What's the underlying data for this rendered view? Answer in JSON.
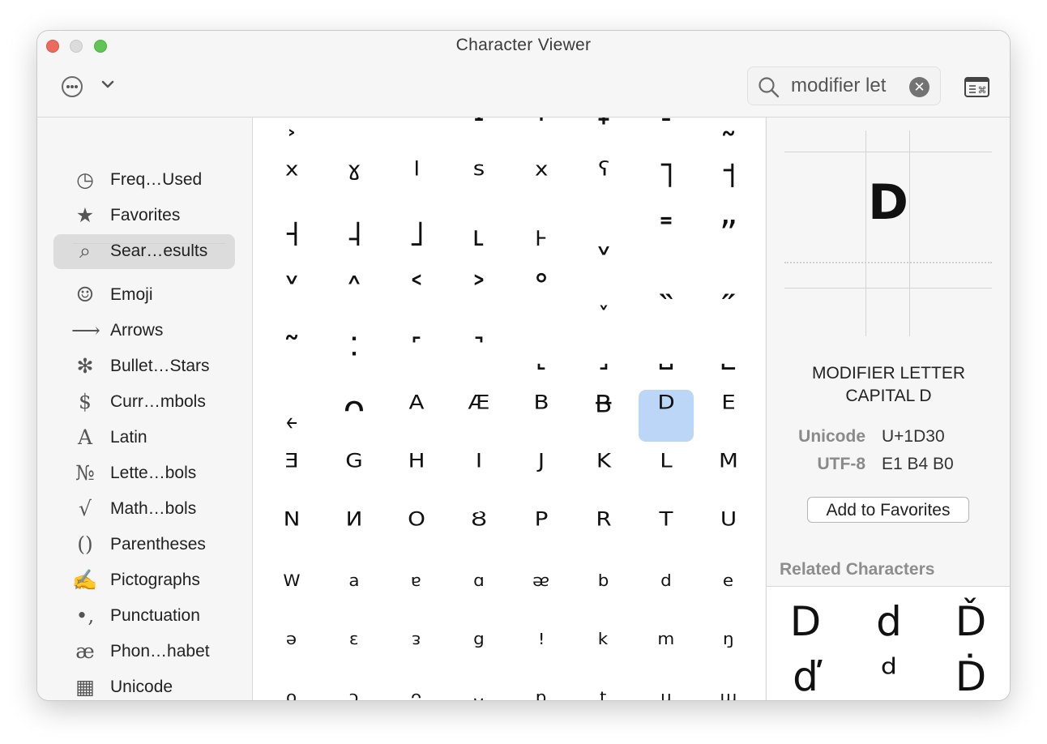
{
  "window": {
    "title": "Character Viewer"
  },
  "toolbar": {
    "search_query": "modifier let",
    "clear_label": "✕"
  },
  "sidebar": {
    "items": [
      {
        "label": "Freq…Used",
        "icon": "clock-icon",
        "glyph": "◷"
      },
      {
        "label": "Favorites",
        "icon": "star-icon",
        "glyph": "★"
      },
      {
        "label": "Sear…esults",
        "icon": "search-icon",
        "glyph": "⌕"
      },
      {
        "label": "Emoji",
        "icon": "smiley-icon",
        "glyph": "☺"
      },
      {
        "label": "Arrows",
        "icon": "arrow-icon",
        "glyph": "⟶"
      },
      {
        "label": "Bullet…Stars",
        "icon": "asterisk-icon",
        "glyph": "✻"
      },
      {
        "label": "Curr…mbols",
        "icon": "dollar-icon",
        "glyph": "$"
      },
      {
        "label": "Latin",
        "icon": "letter-a-icon",
        "glyph": "A"
      },
      {
        "label": "Lette…bols",
        "icon": "numero-icon",
        "glyph": "№"
      },
      {
        "label": "Math…bols",
        "icon": "square-root-icon",
        "glyph": "√"
      },
      {
        "label": "Parentheses",
        "icon": "parentheses-icon",
        "glyph": "()"
      },
      {
        "label": "Pictographs",
        "icon": "hand-writing-icon",
        "glyph": "✍"
      },
      {
        "label": "Punctuation",
        "icon": "punctuation-icon",
        "glyph": "•,"
      },
      {
        "label": "Phon…habet",
        "icon": "ae-ligature-icon",
        "glyph": "æ"
      },
      {
        "label": "Unicode",
        "icon": "grid-icon",
        "glyph": "▦"
      }
    ]
  },
  "grid": {
    "rows": [
      [
        "˲",
        "˃",
        "˂",
        "˔",
        "˕",
        "˖",
        "˗",
        "˷"
      ],
      [
        "ˣ",
        "ˠ",
        "ˡ",
        "ˢ",
        "ˣ",
        "ˤ",
        "˥",
        "˦"
      ],
      [
        "˧",
        "˨",
        "˩",
        "˪",
        "˫",
        "ˬ",
        "˭",
        "ˮ"
      ],
      [
        "˅",
        "˄",
        "˂",
        "˃",
        "˚",
        "˯",
        "˵",
        "˶"
      ],
      [
        "˜",
        "˸",
        "˹",
        "˺",
        "˻",
        "˼",
        "˽",
        "˾"
      ],
      [
        "˿",
        "ᴖ",
        "ᴬ",
        "ᴭ",
        "ᴮ",
        "ᴯ",
        "ᴰ",
        "ᴱ"
      ],
      [
        "ᴲ",
        "ᴳ",
        "ᴴ",
        "ᴵ",
        "ᴶ",
        "ᴷ",
        "ᴸ",
        "ᴹ"
      ],
      [
        "ᴺ",
        "ᴻ",
        "ᴼ",
        "ᴽ",
        "ᴾ",
        "ᴿ",
        "ᵀ",
        "ᵁ"
      ],
      [
        "ᵂ",
        "ᵃ",
        "ᵄ",
        "ᵅ",
        "ᵆ",
        "ᵇ",
        "ᵈ",
        "ᵉ"
      ],
      [
        "ᵊ",
        "ᵋ",
        "ᵌ",
        "ᵍ",
        "ꜝ",
        "ᵏ",
        "ᵐ",
        "ᵑ"
      ],
      [
        "ᵒ",
        "ᵓ",
        "ᵔ",
        "ᵕ",
        "ᵖ",
        "ᵗ",
        "ᵘ",
        "ᵚ"
      ]
    ],
    "selected": "ᴰ"
  },
  "detail": {
    "preview_char": "ᴰ",
    "preview_glyph": "D",
    "name_line1": "MODIFIER LETTER",
    "name_line2": "CAPITAL D",
    "unicode_label": "Unicode",
    "unicode_value": "U+1D30",
    "utf8_label": "UTF-8",
    "utf8_value": "E1 B4 B0",
    "add_favorites_label": "Add to Favorites",
    "related_title": "Related Characters",
    "related": [
      "D",
      "d",
      "Ď",
      "ď",
      "ᵈ",
      "Ḋ"
    ]
  }
}
